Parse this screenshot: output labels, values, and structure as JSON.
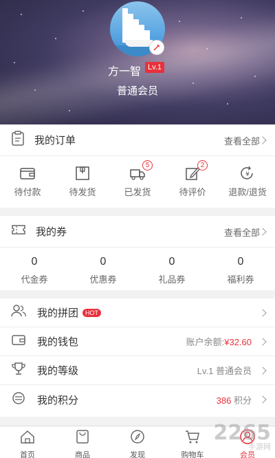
{
  "profile": {
    "name": "方一智",
    "level": "Lv.1",
    "member_type": "普通会员"
  },
  "orders": {
    "title": "我的订单",
    "view_all": "查看全部",
    "items": [
      {
        "label": "待付款",
        "icon": "wallet-icon",
        "badge": ""
      },
      {
        "label": "待发货",
        "icon": "package-icon",
        "badge": ""
      },
      {
        "label": "已发货",
        "icon": "truck-icon",
        "badge": "5"
      },
      {
        "label": "待评价",
        "icon": "edit-icon",
        "badge": "2"
      },
      {
        "label": "退款/退货",
        "icon": "refund-icon",
        "badge": ""
      }
    ]
  },
  "coupons": {
    "title": "我的券",
    "view_all": "查看全部",
    "items": [
      {
        "value": "0",
        "label": "代金券"
      },
      {
        "value": "0",
        "label": "优惠券"
      },
      {
        "value": "0",
        "label": "礼品券"
      },
      {
        "value": "0",
        "label": "福利券"
      }
    ]
  },
  "list": {
    "group_buy": {
      "title": "我的拼团",
      "tag": "HOT"
    },
    "wallet": {
      "title": "我的钱包",
      "prefix": "账户余额:",
      "amount": "¥32.60"
    },
    "level": {
      "title": "我的等级",
      "value": "Lv.1 普通会员"
    },
    "points": {
      "title": "我的积分",
      "amount": "386",
      "unit": "积分"
    }
  },
  "tabbar": [
    {
      "label": "首页",
      "icon": "home-icon",
      "active": false
    },
    {
      "label": "商品",
      "icon": "bag-icon",
      "active": false
    },
    {
      "label": "发现",
      "icon": "compass-icon",
      "active": false
    },
    {
      "label": "购物车",
      "icon": "cart-icon",
      "active": false
    },
    {
      "label": "会员",
      "icon": "user-icon",
      "active": true
    }
  ],
  "watermark": {
    "main": "2265",
    "sub": "手游网"
  },
  "colors": {
    "accent": "#e8313c",
    "text": "#333333",
    "muted": "#888888"
  }
}
